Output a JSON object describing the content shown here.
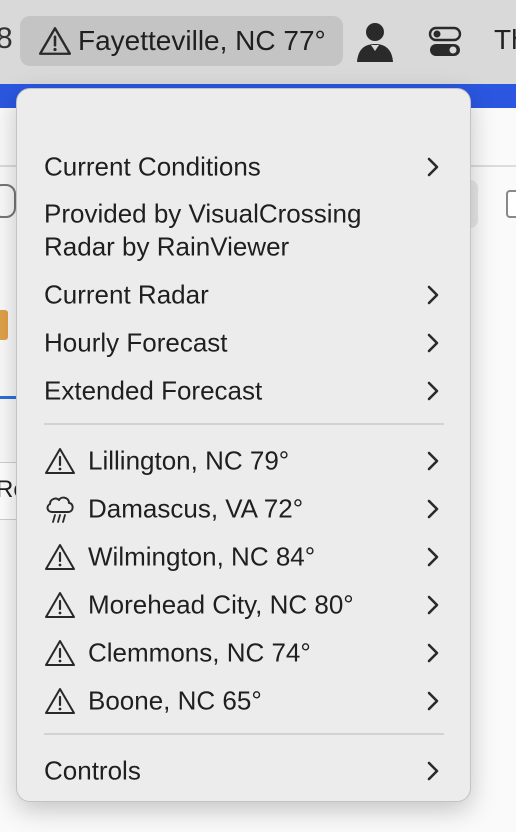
{
  "menubar": {
    "edge_fragment": "8",
    "status_title": "Fayetteville, NC 77°",
    "status_icon": "warning-triangle-icon",
    "user_icon": "user-silhouette-icon",
    "toggle_icon": "control-center-toggle-icon",
    "clipped_item": "Th"
  },
  "background": {
    "accent_color": "#2b57e0",
    "fragment_re": "Re"
  },
  "menu": {
    "top_items": [
      {
        "label": "Current Conditions",
        "has_submenu": true
      },
      {
        "label": "Provided by VisualCrossing",
        "has_submenu": false
      },
      {
        "label": "Radar by RainViewer",
        "has_submenu": false
      },
      {
        "label": "Current Radar",
        "has_submenu": true
      },
      {
        "label": "Hourly Forecast",
        "has_submenu": true
      },
      {
        "label": "Extended Forecast",
        "has_submenu": true
      }
    ],
    "locations": [
      {
        "label": "Lillington, NC 79°",
        "icon": "warning-triangle-icon"
      },
      {
        "label": "Damascus, VA 72°",
        "icon": "cloud-rain-icon"
      },
      {
        "label": "Wilmington, NC 84°",
        "icon": "warning-triangle-icon"
      },
      {
        "label": "Morehead City, NC 80°",
        "icon": "warning-triangle-icon"
      },
      {
        "label": "Clemmons, NC 74°",
        "icon": "warning-triangle-icon"
      },
      {
        "label": "Boone, NC 65°",
        "icon": "warning-triangle-icon"
      }
    ],
    "controls": {
      "label": "Controls",
      "has_submenu": true
    }
  }
}
